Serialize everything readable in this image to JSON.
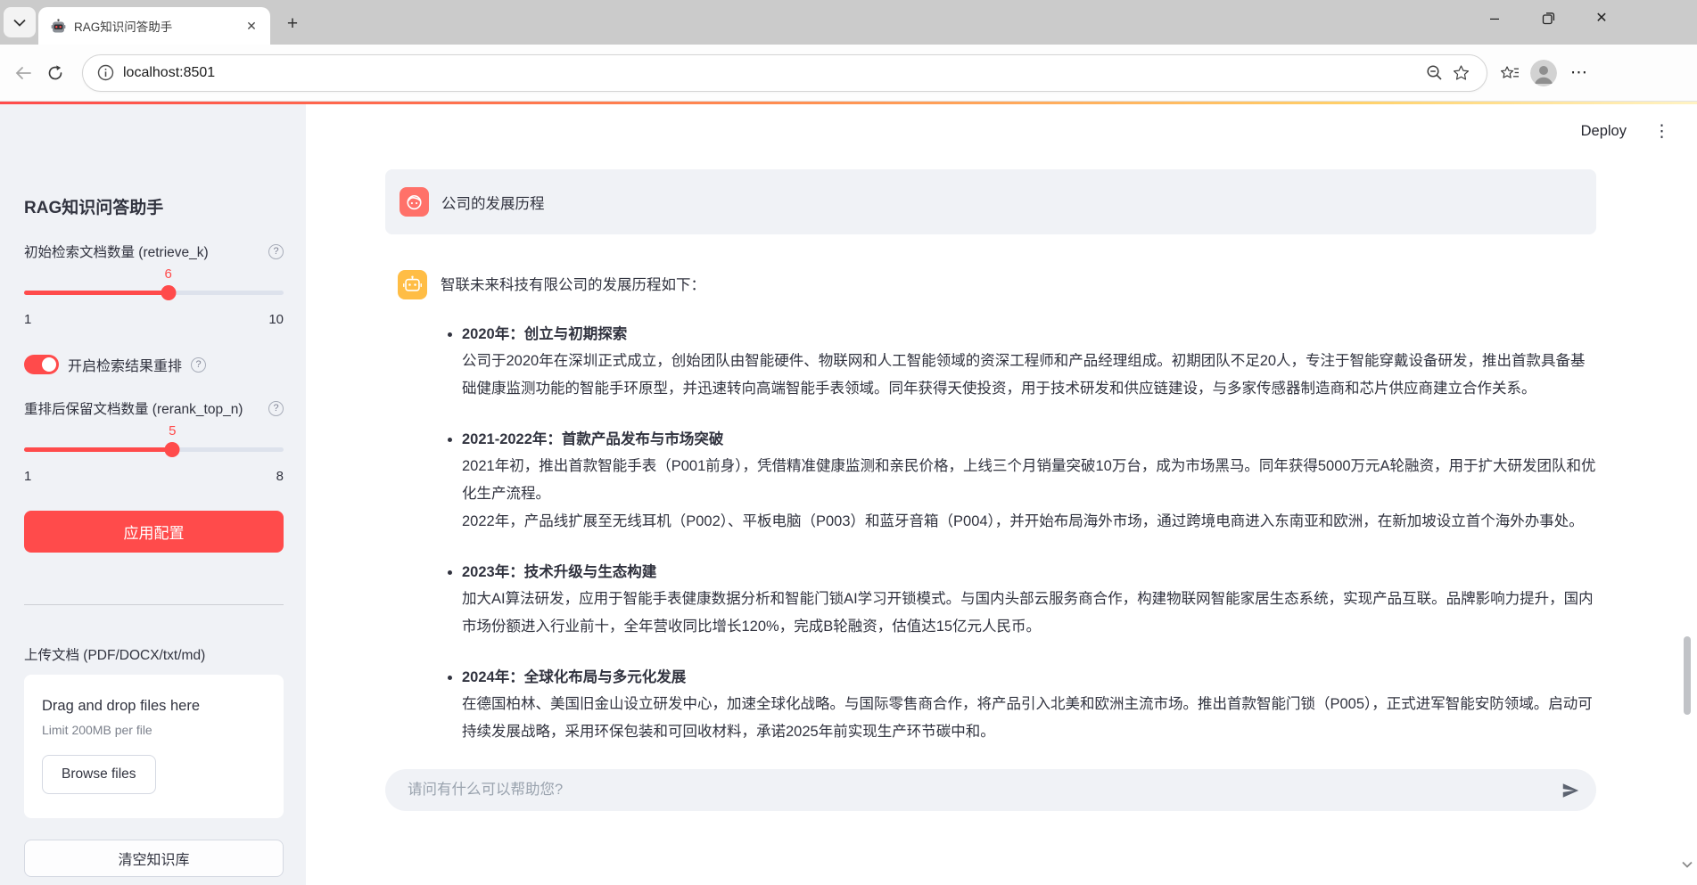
{
  "browser": {
    "tab_title": "RAG知识问答助手",
    "url": "localhost:8501",
    "icons": {
      "tab_search_chevron": "⌄",
      "new_tab": "+",
      "tab_close": "✕",
      "minimize": "–",
      "window_close": "✕",
      "menu_ellipsis": "⋯"
    }
  },
  "app": {
    "deploy_label": "Deploy",
    "menu_icon": "⋮",
    "colors": {
      "accent": "#FF4B4B",
      "assistant_avatar": "#FFBD45",
      "user_avatar": "#FF7169",
      "sidebar_bg": "#F0F2F6",
      "text": "#31333F"
    },
    "sidebar": {
      "title": "RAG知识问答助手",
      "slider_retrieve": {
        "label": "初始检索文档数量 (retrieve_k)",
        "value": 6,
        "min": 1,
        "max": 10,
        "help_icon": "?"
      },
      "toggle_rerank": {
        "label": "开启检索结果重排",
        "state": "on",
        "help_icon": "?"
      },
      "slider_rerank": {
        "label": "重排后保留文档数量 (rerank_top_n)",
        "value": 5,
        "min": 1,
        "max": 8,
        "help_icon": "?"
      },
      "apply_button": "应用配置",
      "upload_label": "上传文档 (PDF/DOCX/txt/md)",
      "uploader": {
        "drag_text": "Drag and drop files here",
        "limit_text": "Limit 200MB per file",
        "browse_button": "Browse files"
      },
      "clear_button": "清空知识库"
    },
    "chat": {
      "user_message": "公司的发展历程",
      "assistant_intro": "智联未来科技有限公司的发展历程如下：",
      "bullets": [
        {
          "heading": "2020年：创立与初期探索",
          "body": [
            "公司于2020年在深圳正式成立，创始团队由智能硬件、物联网和人工智能领域的资深工程师和产品经理组成。初期团队不足20人，专注于智能穿戴设备研发，推出首款具备基础健康监测功能的智能手环原型，并迅速转向高端智能手表领域。同年获得天使投资，用于技术研发和供应链建设，与多家传感器制造商和芯片供应商建立合作关系。"
          ]
        },
        {
          "heading": "2021-2022年：首款产品发布与市场突破",
          "body": [
            "2021年初，推出首款智能手表（P001前身），凭借精准健康监测和亲民价格，上线三个月销量突破10万台，成为市场黑马。同年获得5000万元A轮融资，用于扩大研发团队和优化生产流程。",
            "2022年，产品线扩展至无线耳机（P002）、平板电脑（P003）和蓝牙音箱（P004），并开始布局海外市场，通过跨境电商进入东南亚和欧洲，在新加坡设立首个海外办事处。"
          ]
        },
        {
          "heading": "2023年：技术升级与生态构建",
          "body": [
            "加大AI算法研发，应用于智能手表健康数据分析和智能门锁AI学习开锁模式。与国内头部云服务商合作，构建物联网智能家居生态系统，实现产品互联。品牌影响力提升，国内市场份额进入行业前十，全年营收同比增长120%，完成B轮融资，估值达15亿元人民币。"
          ]
        },
        {
          "heading": "2024年：全球化布局与多元化发展",
          "body": [
            "在德国柏林、美国旧金山设立研发中心，加速全球化战略。与国际零售商合作，将产品引入北美和欧洲主流市场。推出首款智能门锁（P005），正式进军智能安防领域。启动可持续发展战略，采用环保包装和可回收材料，承诺2025年前实现生产环节碳中和。"
          ]
        }
      ],
      "input_placeholder": "请问有什么可以帮助您?"
    }
  }
}
